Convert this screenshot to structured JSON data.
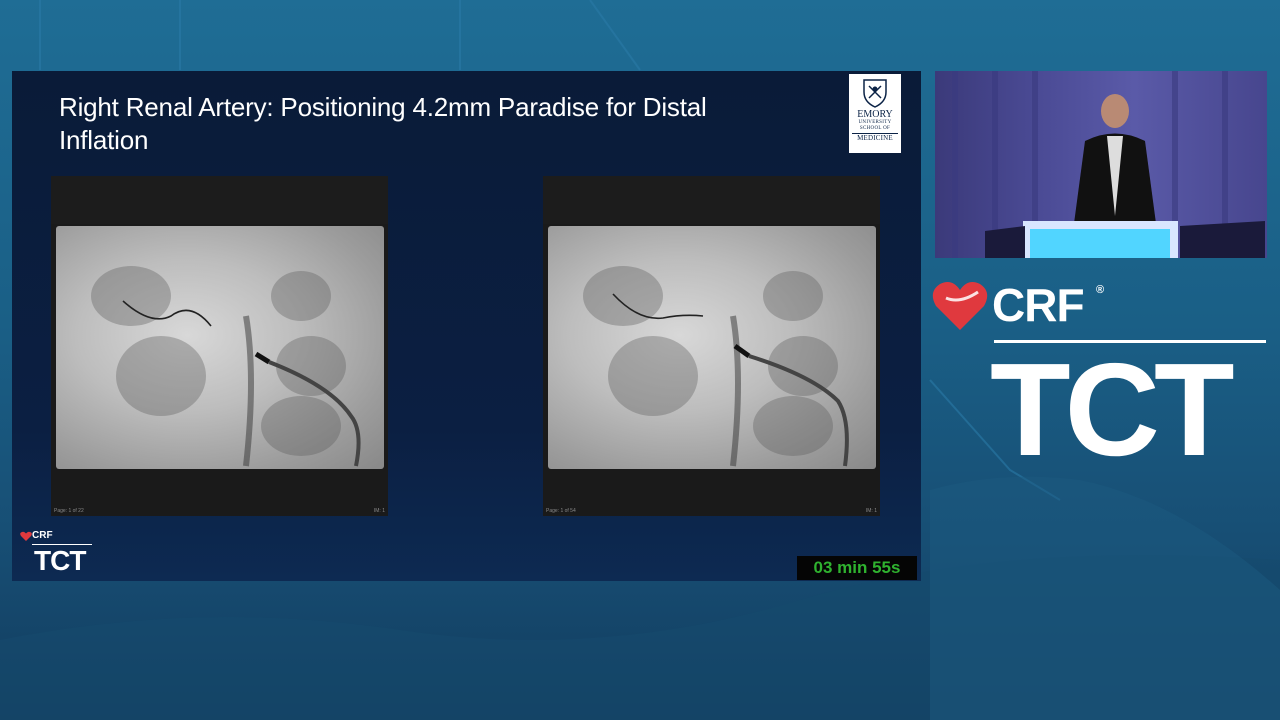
{
  "slide": {
    "title": "Right Renal Artery: Positioning 4.2mm Paradise for Distal Inflation",
    "logo": {
      "line1": "EMORY",
      "line2": "UNIVERSITY",
      "line3": "SCHOOL OF",
      "line4": "MEDICINE"
    },
    "images": [
      {
        "footer_left": "Page: 1 of 22",
        "footer_right": "IM: 1"
      },
      {
        "footer_left": "Page: 1 of 54",
        "footer_right": "IM: 1"
      }
    ],
    "small_brand": {
      "crf": "CRF",
      "tct": "TCT"
    }
  },
  "timer": {
    "text": "03 min 55s"
  },
  "brand": {
    "crf": "CRF",
    "registered": "®",
    "tct": "TCT"
  },
  "colors": {
    "accent_red": "#e0393e",
    "timer_green": "#2fb22f",
    "slide_bg": "#0b1f42"
  }
}
